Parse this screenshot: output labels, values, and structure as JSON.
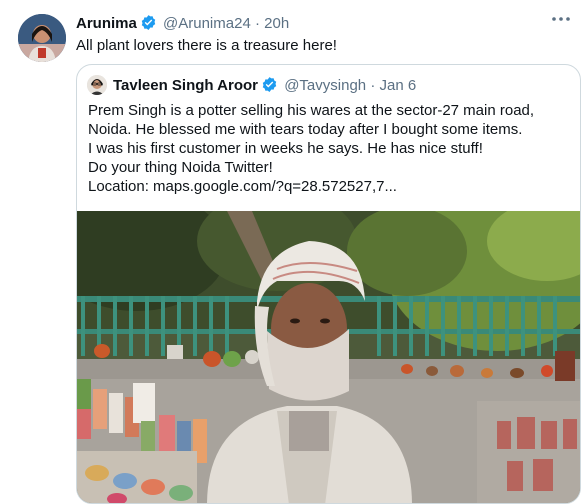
{
  "tweet": {
    "author_name": "Arunima",
    "handle": "@Arunima24",
    "separator": "·",
    "time": "20h",
    "text": "All plant lovers there is a treasure here!",
    "verified_icon": "verified-badge-icon",
    "menu_icon": "more-icon"
  },
  "quoted": {
    "author_name": "Tavleen Singh Aroor",
    "handle": "@Tavysingh",
    "separator": "·",
    "time": "Jan 6",
    "lines": [
      "Prem Singh is a potter selling his wares at the sector-27 main road,",
      "Noida. He blessed me with tears today after I bought some items.",
      "I was his first customer in weeks he says. He has nice stuff!",
      "Do your thing Noida Twitter!",
      "Location: maps.google.com/?q=28.572527,7..."
    ],
    "photo_icon": "tweet-photo"
  },
  "colors": {
    "verified": "#1d9bf0",
    "muted": "#5b7083",
    "border": "#cfd9de"
  }
}
